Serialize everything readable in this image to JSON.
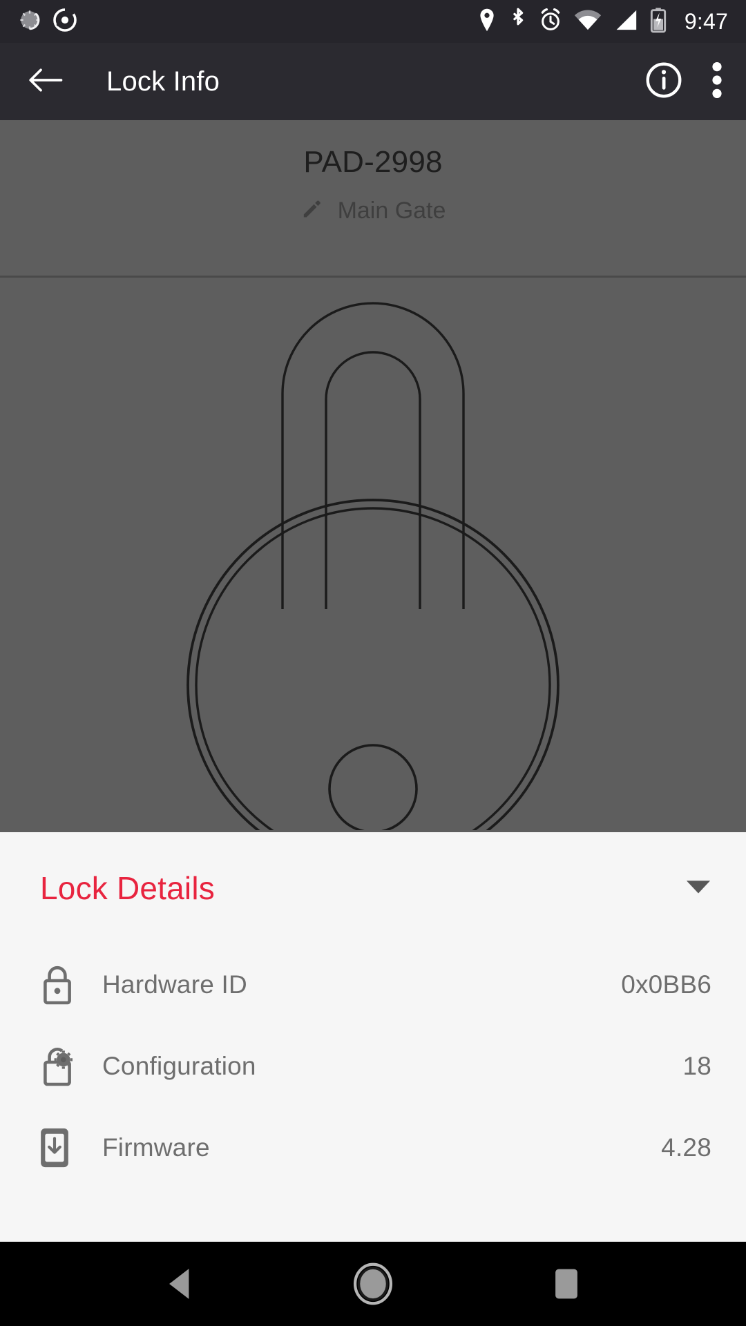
{
  "status_bar": {
    "time": "9:47",
    "left_icons": [
      {
        "name": "sync-spinner-icon"
      },
      {
        "name": "compass-icon"
      }
    ],
    "right_icons": [
      {
        "name": "location-pin-icon"
      },
      {
        "name": "bluetooth-icon"
      },
      {
        "name": "alarm-clock-icon"
      },
      {
        "name": "wifi-icon"
      },
      {
        "name": "cellular-signal-icon"
      },
      {
        "name": "battery-charging-icon"
      }
    ]
  },
  "app_bar": {
    "back_icon": "arrow-back-icon",
    "title": "Lock Info",
    "info_icon": "info-circle-icon",
    "overflow_icon": "more-vert-icon"
  },
  "hero": {
    "lock_name": "PAD-2998",
    "edit_icon": "pencil-edit-icon",
    "location_label": "Main Gate",
    "illustration": "padlock-outline-illustration"
  },
  "details": {
    "section_title": "Lock Details",
    "section_title_color": "#e8243f",
    "expand_icon": "chevron-down-icon",
    "rows": [
      {
        "icon": "padlock-icon",
        "label": "Hardware ID",
        "value": "0x0BB6"
      },
      {
        "icon": "lock-gear-icon",
        "label": "Configuration",
        "value": "18"
      },
      {
        "icon": "firmware-chip-icon",
        "label": "Firmware",
        "value": "4.28"
      }
    ]
  },
  "nav_bar": {
    "back": "nav-back-icon",
    "home": "nav-home-icon",
    "recents": "nav-recents-icon"
  }
}
